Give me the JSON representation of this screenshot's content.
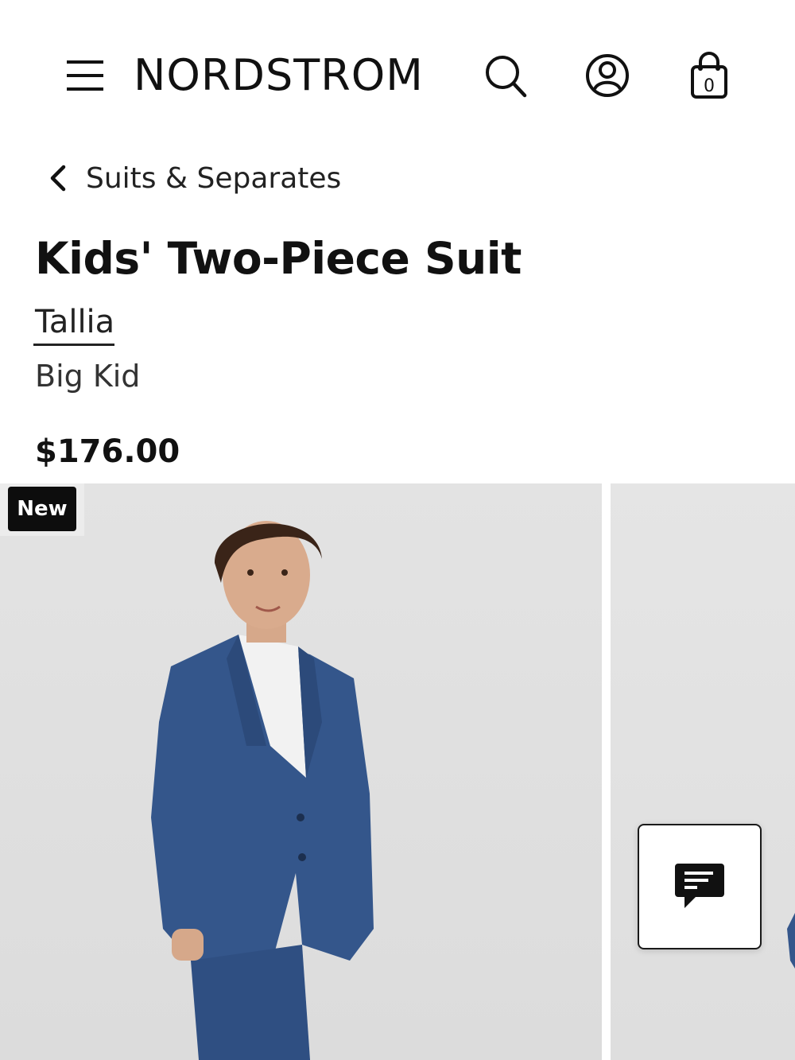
{
  "header": {
    "logo": "NORDSTROM",
    "bag_count": "0",
    "icons": [
      "menu-icon",
      "search-icon",
      "account-icon",
      "shopping-bag-icon"
    ]
  },
  "breadcrumb": {
    "label": "Suits & Separates",
    "icon": "chevron-left-icon"
  },
  "product": {
    "title": "Kids' Two-Piece Suit",
    "brand": "Tallia",
    "size_group": "Big Kid",
    "price": "$176.00"
  },
  "gallery": {
    "badge": "New",
    "chat_icon": "chat-icon"
  },
  "colors": {
    "text": "#111111",
    "badge_bg": "#0d0d0d",
    "photo_bg": "#e0e0e0",
    "suit_blue": "#34568b"
  }
}
